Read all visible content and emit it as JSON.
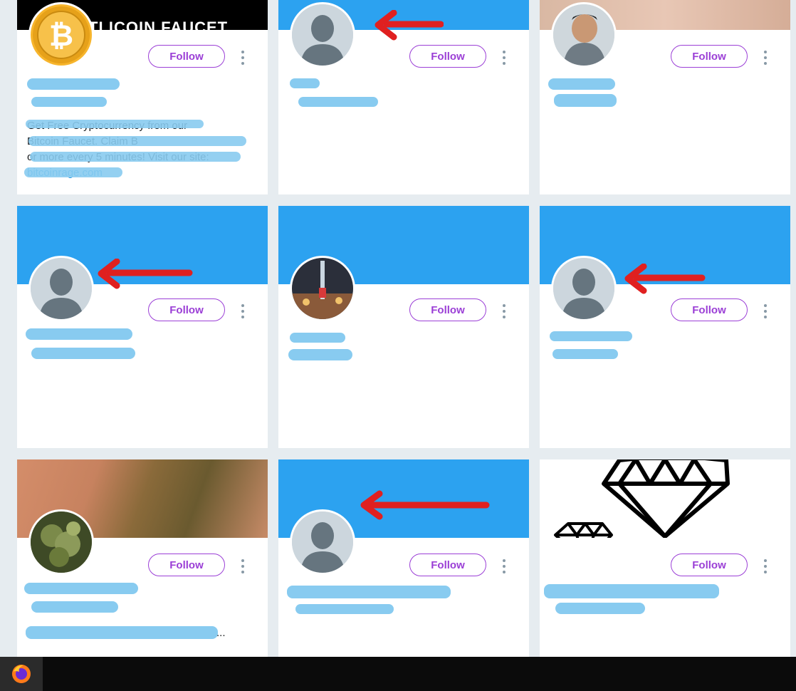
{
  "follow_label": "Follow",
  "cards": [
    {
      "id": 1,
      "banner_text": "TLICOIN FAUCET",
      "bio_lines": [
        "Get Free Cryptocurrency from our",
        "Bitcoin Faucet. Claim B",
        "or more every 5 minutes! Visit our site:"
      ],
      "bio_link": "bitcoinrage.com"
    },
    {
      "id": 2,
      "banner_text": ""
    },
    {
      "id": 3
    },
    {
      "id": 4
    },
    {
      "id": 5
    },
    {
      "id": 6
    },
    {
      "id": 7,
      "bio_lines": [
        "..."
      ]
    },
    {
      "id": 8
    },
    {
      "id": 9
    }
  ],
  "colors": {
    "accent": "#9b3fd6",
    "banner_blue": "#2ca2f0",
    "redaction": "#88cbf0",
    "annotation_arrow": "#e02020",
    "page_bg": "#e6ecf0"
  },
  "taskbar": {
    "pinned_apps": [
      "firefox-icon"
    ]
  }
}
